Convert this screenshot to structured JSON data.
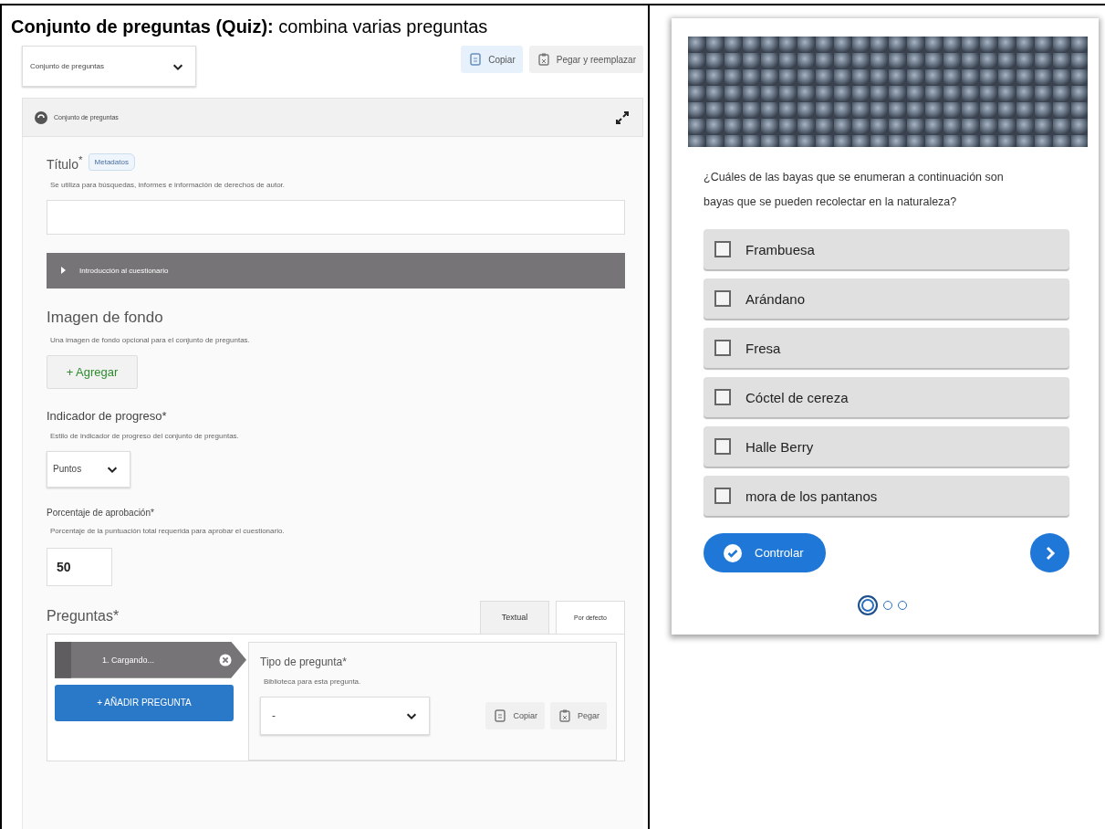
{
  "heading": "**Conjunto de preguntas (Quiz):** combina varias preguntas",
  "editor": {
    "library_select": "Conjunto de preguntas",
    "copy_button": "Copiar",
    "paste_replace_button": "Pegar y reemplazar",
    "header_title": "Conjunto de preguntas",
    "title_field": {
      "label": "Título$^{*}$",
      "metadata_button": "Metadatos",
      "description": "Se utiliza para búsquedas, informes e información de derechos de autor."
    },
    "intro_section": {
      "label": "Introducción al cuestionario",
      "expanded": false
    },
    "background": {
      "label": "Imagen de fondo",
      "description": "Una imagen de fondo opcional para el conjunto de preguntas.",
      "add_button": "+ Agregar"
    },
    "progress": {
      "label": "Indicador de progreso*",
      "description": "Estilo de indicador de progreso del conjunto de preguntas.",
      "value": "Puntos"
    },
    "pass_percentage": {
      "label": "Porcentaje de aprobación*",
      "description": "Porcentaje de la puntuación total requerida para aprobar el cuestionario.",
      "value": "50"
    },
    "questions": {
      "label": "Preguntas*",
      "tabs": [
        {
          "label": "Textual",
          "selected": false
        },
        {
          "label": "Por defecto",
          "selected": true
        }
      ],
      "items": [
        {
          "label": "1. Cargando..."
        }
      ],
      "add_button": "+ AÑADIR PREGUNTA",
      "type_label": "Tipo de pregunta*",
      "type_description": "Biblioteca para esta pregunta.",
      "type_value": "-",
      "copy_button": "Copiar",
      "paste_button": "Pegar"
    }
  },
  "quiz": {
    "question": "¿Cuáles de las bayas que se enumeran a continuación son bayas que se pueden recolectar en la naturaleza?",
    "options": [
      {
        "label": "Frambuesa",
        "checked": false
      },
      {
        "label": "Arándano",
        "checked": false
      },
      {
        "label": "Fresa",
        "checked": false
      },
      {
        "label": "Cóctel de cereza",
        "checked": false
      },
      {
        "label": "Halle Berry",
        "checked": false
      },
      {
        "label": "mora de los pantanos",
        "checked": false
      }
    ],
    "check_button": "Controlar",
    "pages": [
      {
        "selected": true
      },
      {
        "selected": false
      },
      {
        "selected": false
      }
    ]
  }
}
